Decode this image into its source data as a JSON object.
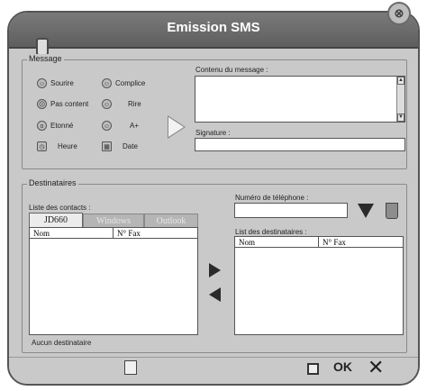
{
  "window": {
    "title": "Emission SMS",
    "close_symbol": "⊗"
  },
  "message": {
    "legend": "Message",
    "emoticons": [
      [
        "Sourire",
        "Complice"
      ],
      [
        "Pas content",
        "Rire"
      ],
      [
        "Etonné",
        "A+"
      ],
      [
        "Heure",
        "Date"
      ]
    ],
    "content_label": "Contenu du message :",
    "content_value": "",
    "signature_label": "Signature :",
    "signature_value": ""
  },
  "destinataires": {
    "legend": "Destinataires",
    "contacts_label": "Liste des contacts :",
    "tabs": [
      "JD660",
      "Windows",
      "Outlook"
    ],
    "active_tab": "JD660",
    "contacts_columns": [
      "Nom",
      "N° Fax"
    ],
    "phone_label": "Numéro de téléphone :",
    "phone_value": "",
    "recipients_label": "List des destinataires :",
    "recipients_columns": [
      "Nom",
      "N° Fax"
    ],
    "status": "Aucun destinataire"
  },
  "bottom": {
    "ok_label": "OK",
    "close_label": "✕"
  }
}
